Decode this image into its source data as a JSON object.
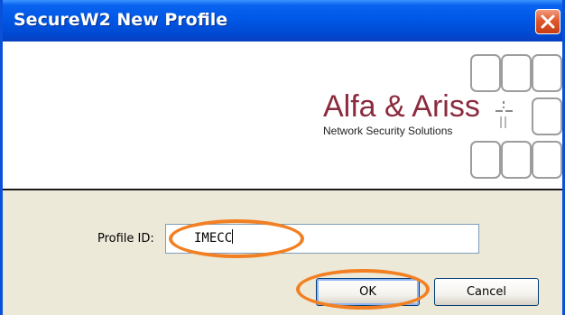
{
  "window": {
    "title": "SecureW2 New Profile"
  },
  "icons": {
    "close": "close-icon",
    "logo_mark": "vendor-logo-icon"
  },
  "banner": {
    "company_name": "Alfa & Ariss",
    "tagline": "Network Security Solutions"
  },
  "form": {
    "profile_id_label": "Profile ID:",
    "profile_id_value": "IMECC"
  },
  "buttons": {
    "ok_label": "OK",
    "cancel_label": "Cancel"
  },
  "colors": {
    "titlebar": "#0058e6",
    "brand": "#8a2b3e",
    "highlight": "#f28023",
    "dialog_background": "#ece9d8"
  }
}
